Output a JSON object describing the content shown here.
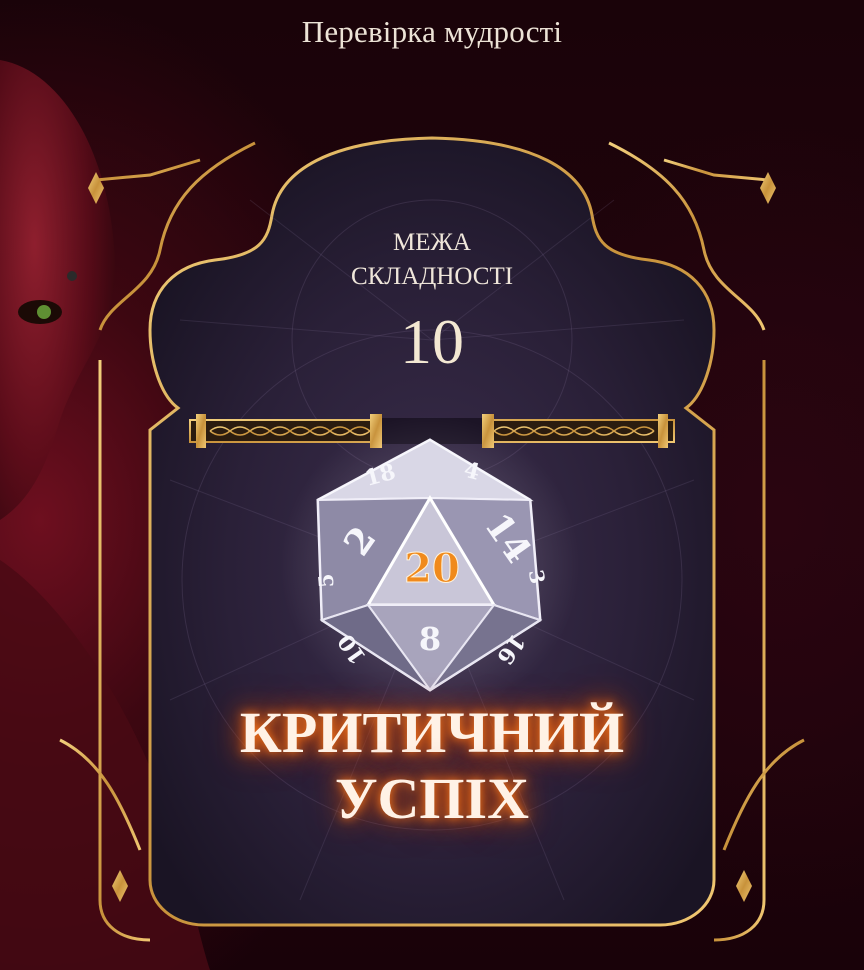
{
  "check": {
    "title": "Перевірка мудрості"
  },
  "difficulty": {
    "label": "МЕЖА\nСКЛАДНОСТІ",
    "value": "10"
  },
  "die": {
    "rolled": "20",
    "faces": [
      "18",
      "4",
      "2",
      "14",
      "3",
      "5",
      "8",
      "10",
      "16"
    ]
  },
  "result": {
    "text": "КРИТИЧНИЙ\nУСПІХ"
  },
  "colors": {
    "gold": "#d7a750",
    "panel": "#241a33",
    "glow": "#ff7a1a",
    "rolled_number": "#f08a1c"
  }
}
